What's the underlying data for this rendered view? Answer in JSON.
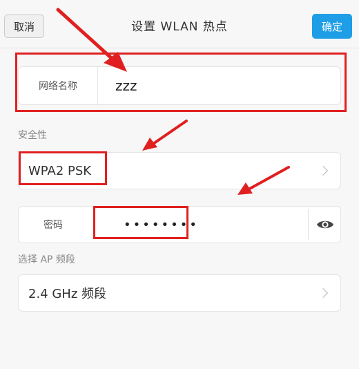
{
  "header": {
    "cancel_label": "取消",
    "title": "设置 WLAN 热点",
    "confirm_label": "确定"
  },
  "ssid": {
    "label": "网络名称",
    "value": "zzz"
  },
  "security": {
    "section_label": "安全性",
    "value": "WPA2 PSK"
  },
  "password": {
    "label": "密码",
    "value": "zzzzzzzz"
  },
  "band": {
    "section_label": "选择 AP 频段",
    "value": "2.4 GHz 频段"
  },
  "colors": {
    "accent": "#1e9ee6",
    "annotation_red": "#e02020"
  }
}
